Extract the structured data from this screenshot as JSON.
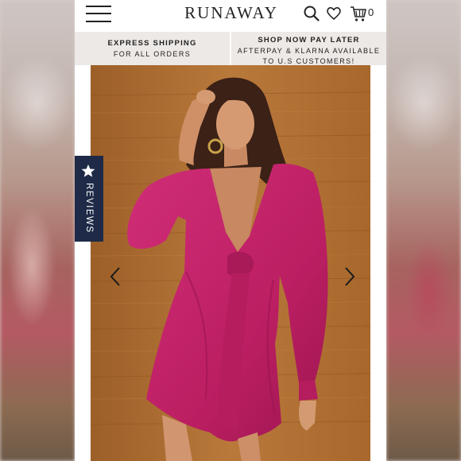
{
  "header": {
    "brand": "RUNAWAY",
    "cart_count": "0",
    "icons": [
      "hamburger-menu-icon",
      "search-icon",
      "heart-icon",
      "cart-icon"
    ]
  },
  "promo": {
    "left_title": "EXPRESS SHIPPING",
    "left_subtitle": "FOR ALL ORDERS",
    "right_title": "SHOP NOW PAY LATER",
    "right_subtitle_line1": "AFTERPAY & KLARNA AVAILABLE",
    "right_subtitle_line2": "TO U.S CUSTOMERS!"
  },
  "reviews_tab": {
    "label": "REVIEWS",
    "icon": "star-icon",
    "color": "#1e2a47"
  },
  "gallery": {
    "prev_icon": "chevron-left-icon",
    "next_icon": "chevron-right-icon",
    "dress_color": "#c3246a",
    "wall_color": "#b07233"
  }
}
